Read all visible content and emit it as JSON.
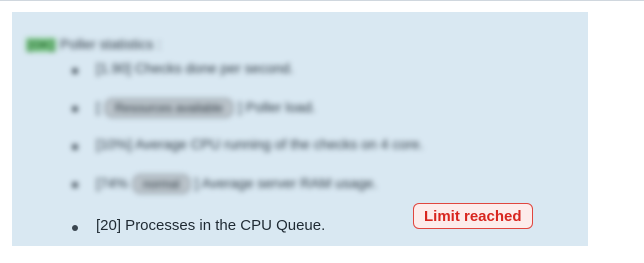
{
  "poller": {
    "status_tag": "[OK]",
    "heading": "Poller statistics :",
    "stats": [
      {
        "prefix": "[1.90]",
        "text": "Checks done per second."
      },
      {
        "prefix": "[",
        "badge": "Resources available",
        "text": "] Poller load."
      },
      {
        "prefix": "[10%]",
        "text": "Average CPU running of the checks on 4 core."
      },
      {
        "prefix": "[74%",
        "badge": "normal",
        "text": "] Average server RAM usage."
      }
    ],
    "queue": {
      "text": "[20] Processes in the CPU Queue.",
      "badge": "Limit reached",
      "badge_color": "#d8261f"
    }
  },
  "colors": {
    "panel_bg": "#d9e8f2",
    "ok_tag": "#7ecb8a",
    "alert": "#e0463f"
  }
}
